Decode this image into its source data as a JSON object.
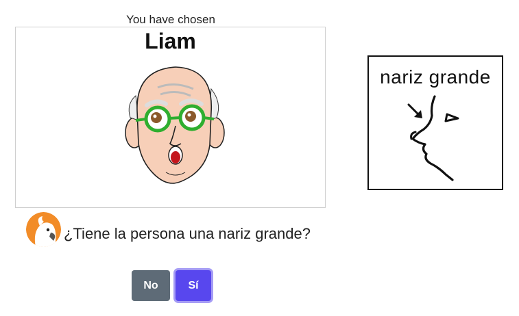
{
  "header": {
    "chosen_label": "You have chosen"
  },
  "character": {
    "name": "Liam",
    "image_description_icon": "bald-man-green-glasses-face"
  },
  "symbol": {
    "label": "nariz grande",
    "icon": "big-nose-pictogram"
  },
  "question": {
    "avatar_icon": "cockatoo-avatar",
    "text": "¿Tiene la persona una nariz grande?"
  },
  "buttons": {
    "no_label": "No",
    "yes_label": "Sí"
  },
  "colors": {
    "no_button": "#5e6b77",
    "yes_button": "#5847ee",
    "avatar_bg": "#f28c28",
    "glasses": "#2fae2f"
  }
}
